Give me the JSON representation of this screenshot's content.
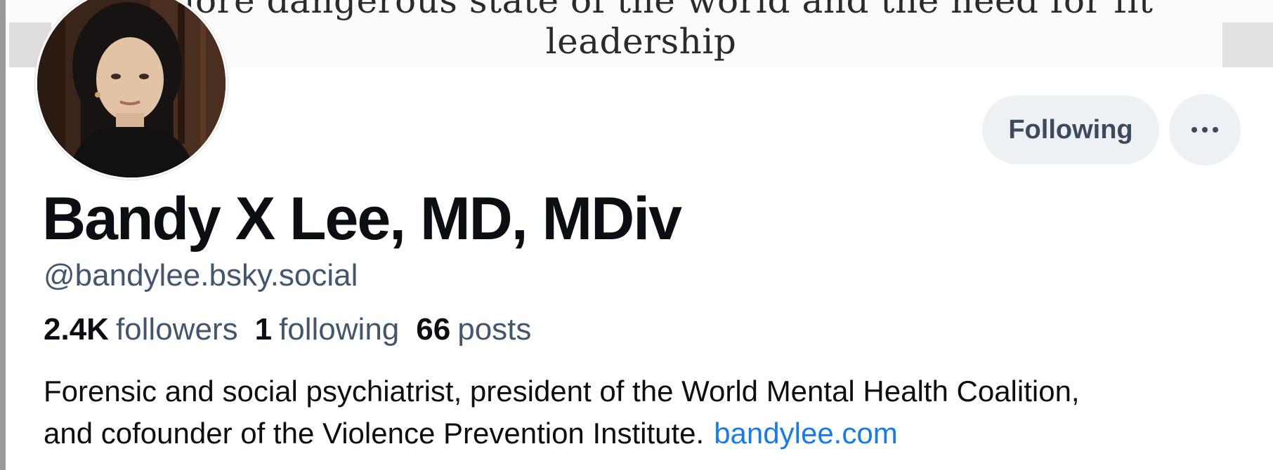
{
  "banner": {
    "line1": "e more dangerous state of the world and the need for fit",
    "line2": "leadership"
  },
  "profile": {
    "display_name": "Bandy X Lee, MD, MDiv",
    "handle": "@bandylee.bsky.social",
    "avatar_icon": "profile-photo"
  },
  "actions": {
    "following_label": "Following",
    "more_icon": "ellipsis-icon"
  },
  "stats": {
    "followers_count": "2.4K",
    "followers_label": "followers",
    "following_count": "1",
    "following_label": "following",
    "posts_count": "66",
    "posts_label": "posts"
  },
  "bio": {
    "line1": "Forensic and social psychiatrist, president of the World Mental Health Coalition,",
    "line2": "and cofounder of the Violence Prevention Institute.",
    "link": "bandylee.com"
  },
  "colors": {
    "name_text": "#0b0f14",
    "muted_text": "#44566c",
    "link": "#1a7ae6",
    "button_bg": "#eef1f4"
  }
}
